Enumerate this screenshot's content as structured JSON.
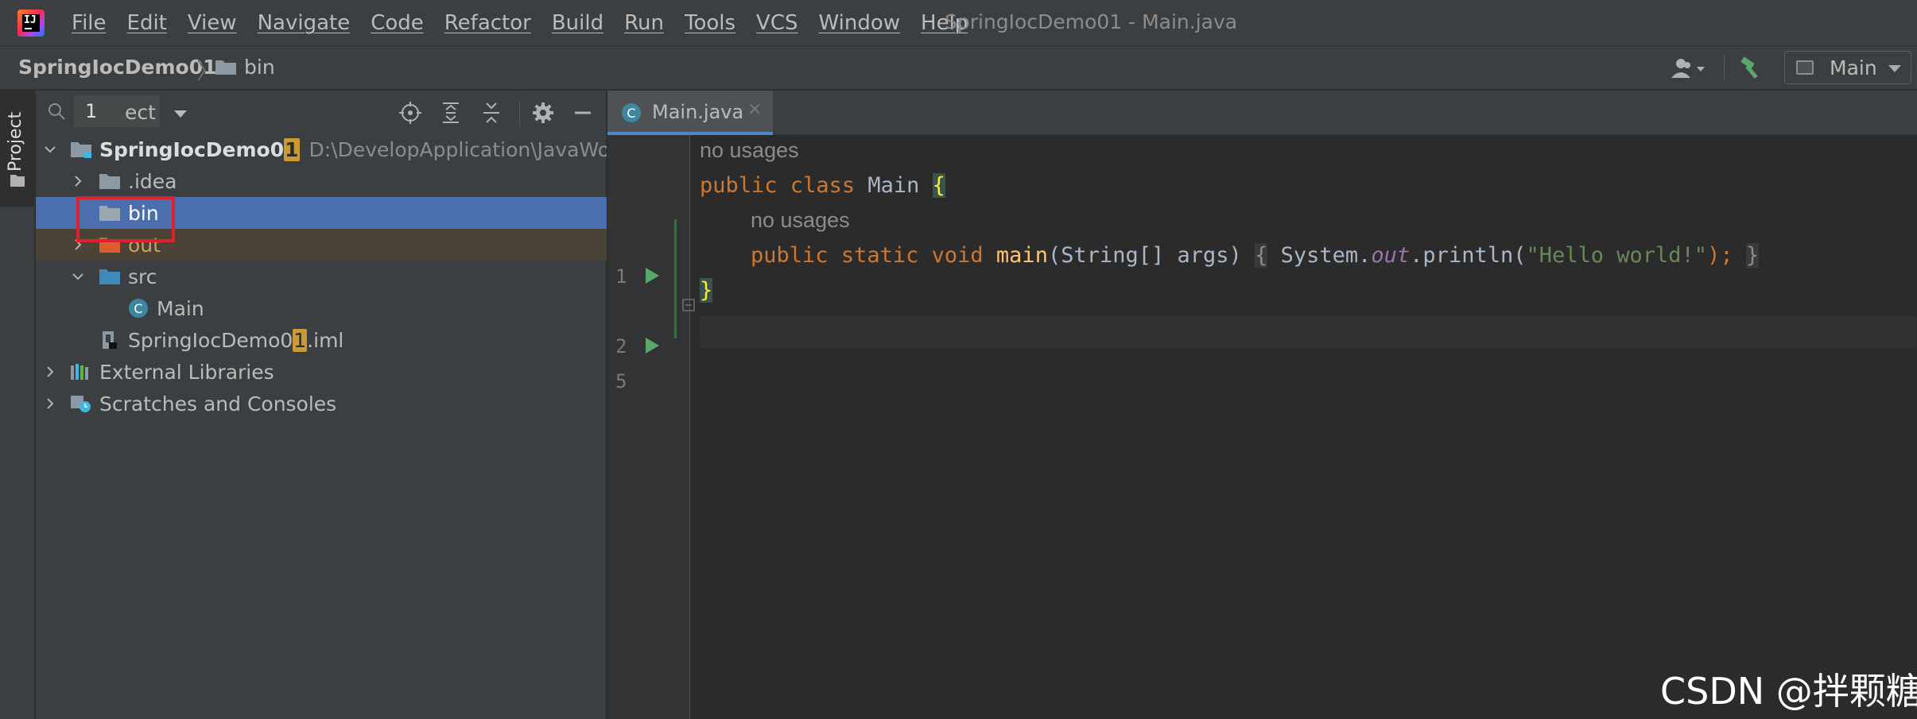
{
  "app": {
    "logo_icon": "intellij-idea-logo-icon",
    "window_title": "SpringIocDemo01 - Main.java"
  },
  "menu": {
    "items": [
      "File",
      "Edit",
      "View",
      "Navigate",
      "Code",
      "Refactor",
      "Build",
      "Run",
      "Tools",
      "VCS",
      "Window",
      "Help"
    ]
  },
  "navbar": {
    "project": "SpringIocDemo01",
    "folder": "bin",
    "run_config": "Main"
  },
  "tool_stripe": {
    "project_label": "Project"
  },
  "project_panel": {
    "search_text": "1",
    "view_label": "ect",
    "tree": [
      {
        "label_before": "SpringIocDemo0",
        "label_hl": "1",
        "label_after": "",
        "path": "D:\\DevelopApplication\\JavaWorkSp",
        "icon": "module-icon",
        "expanded": true
      },
      {
        "label": ".idea",
        "icon": "folder-icon",
        "expanded": false
      },
      {
        "label": "bin",
        "icon": "folder-icon",
        "selected": true
      },
      {
        "label": "out",
        "icon": "excluded-folder-icon",
        "expanded": false
      },
      {
        "label": "src",
        "icon": "source-folder-icon",
        "expanded": true
      },
      {
        "label": "Main",
        "icon": "java-class-icon"
      },
      {
        "label_before": "SpringIocDemo0",
        "label_hl": "1",
        "label_after": ".iml",
        "icon": "iml-file-icon"
      },
      {
        "label": "External Libraries",
        "icon": "libraries-icon",
        "expanded": false
      },
      {
        "label": "Scratches and Consoles",
        "icon": "scratches-icon",
        "expanded": false
      }
    ]
  },
  "editor": {
    "tab_label": "Main.java",
    "tab_close": "×",
    "line_numbers": [
      "1",
      "2",
      "5"
    ],
    "inlay_hint": "no usages",
    "code": {
      "line1": {
        "kw1": "public",
        "kw2": "class",
        "name": "Main",
        "brace": "{"
      },
      "line2": {
        "kw1": "public",
        "kw2": "static",
        "kw3": "void",
        "method": "main",
        "params": "(String[] args)",
        "open": "{",
        "recv": "System.",
        "field": "out",
        "call": ".println(",
        "str": "\"Hello world!\"",
        "end": ");",
        "close": "}"
      },
      "line5": {
        "brace": "}"
      }
    }
  },
  "watermark": "CSDN @拌颗糖",
  "colors": {
    "selection": "#4b6eaf",
    "keyword": "#cc7832",
    "string": "#6a8759",
    "method": "#ffc66d",
    "highlight_box": "#e0202a"
  }
}
